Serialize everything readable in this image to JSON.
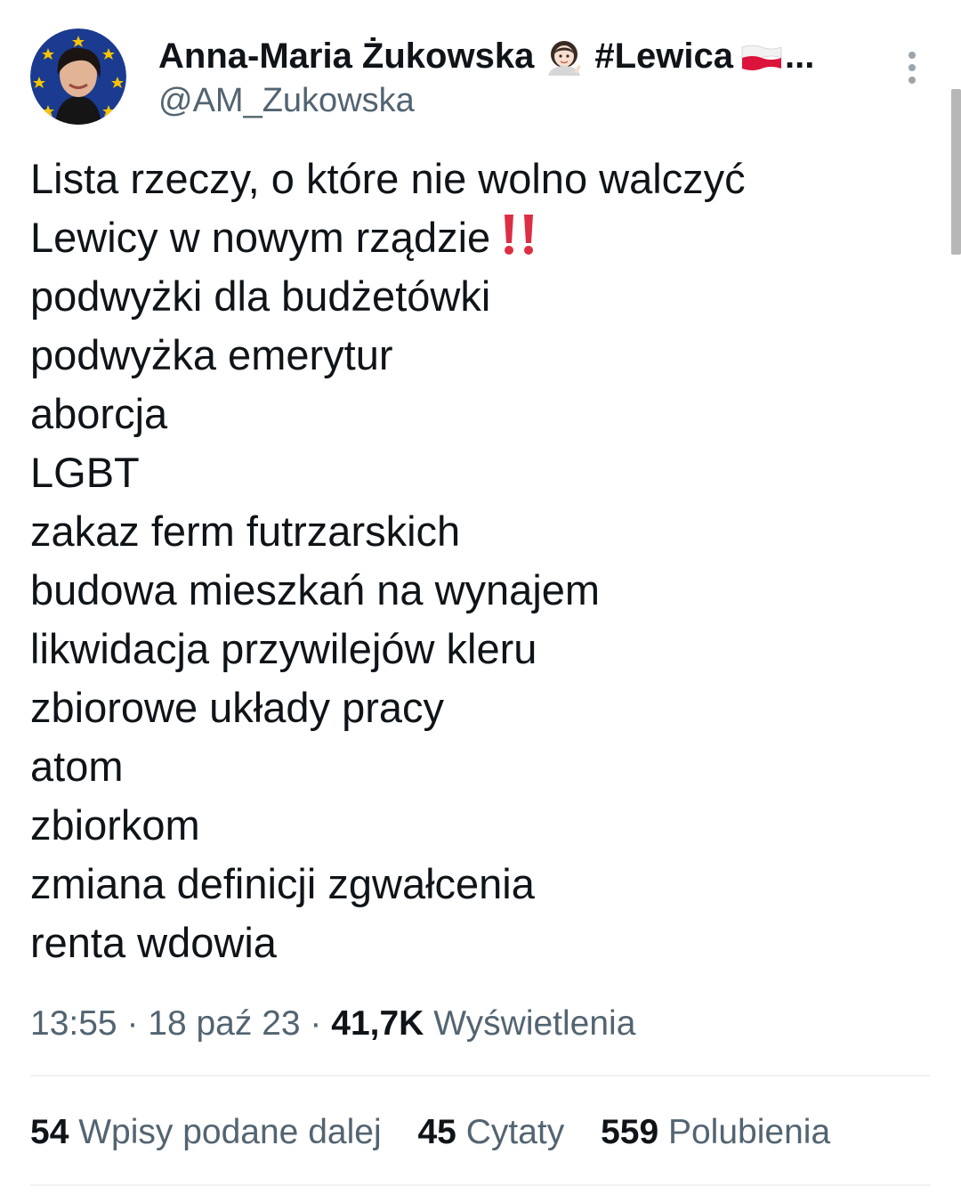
{
  "author": {
    "display_name": "Anna-Maria Żukowska",
    "name_suffix": "#Lewica",
    "handle": "@AM_Zukowska"
  },
  "tweet": {
    "line1": "Lista rzeczy, o które nie wolno walczyć",
    "line2": "Lewicy w nowym rządzie",
    "items": [
      "podwyżki dla budżetówki",
      "podwyżka emerytur",
      "aborcja",
      "LGBT",
      "zakaz ferm futrzarskich",
      "budowa mieszkań na wynajem",
      "likwidacja przywilejów kleru",
      "zbiorowe układy pracy",
      "atom",
      "zbiorkom",
      "zmiana definicji zgwałcenia",
      "renta wdowia"
    ]
  },
  "meta": {
    "time": "13:55",
    "separator": " · ",
    "date": "18 paź 23",
    "views_count": "41,7K",
    "views_label": "Wyświetlenia"
  },
  "stats": {
    "retweets_count": "54",
    "retweets_label": "Wpisy podane dalej",
    "quotes_count": "45",
    "quotes_label": "Cytaty",
    "likes_count": "559",
    "likes_label": "Polubienia"
  },
  "icons": {
    "avatar": "avatar-photo",
    "name_emoji": "woman-tipping-hand-emoji",
    "flag": "poland-flag-emoji",
    "more": "more-vertical-icon",
    "bangs": "double-exclamation-emoji"
  },
  "colors": {
    "text_primary": "#0f1419",
    "text_secondary": "#536471",
    "divider": "#eff3f4",
    "exclamation_red": "#dd2e44"
  }
}
